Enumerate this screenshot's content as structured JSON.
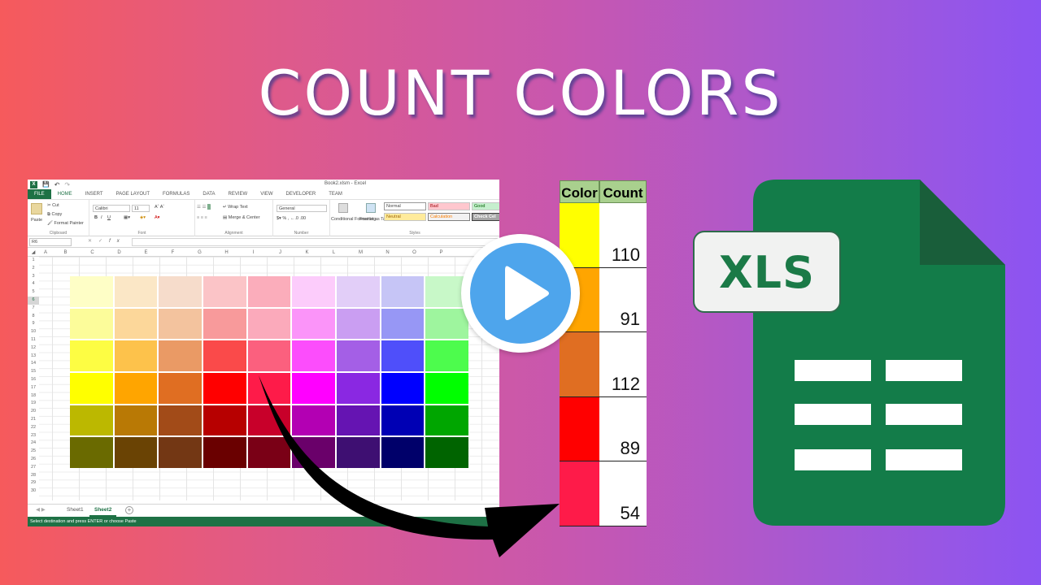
{
  "title": "COUNT COLORS",
  "excel": {
    "window_title": "Book2.xlsm - Excel",
    "tabs": [
      "FILE",
      "HOME",
      "INSERT",
      "PAGE LAYOUT",
      "FORMULAS",
      "DATA",
      "REVIEW",
      "VIEW",
      "DEVELOPER",
      "TEAM"
    ],
    "active_tab": "HOME",
    "ribbon": {
      "clipboard": {
        "paste": "Paste",
        "cut": "Cut",
        "copy": "Copy",
        "format_painter": "Format Painter",
        "label": "Clipboard"
      },
      "font": {
        "font_name": "Calibri",
        "font_size": "11",
        "bold": "B",
        "italic": "I",
        "underline": "U",
        "label": "Font"
      },
      "alignment": {
        "wrap_text": "Wrap Text",
        "merge_center": "Merge & Center",
        "label": "Alignment"
      },
      "number": {
        "format": "General",
        "label": "Number"
      },
      "styles": {
        "conditional_formatting": "Conditional Formatting",
        "format_as_table": "Format as Table",
        "cells": [
          "Normal",
          "Bad",
          "Good",
          "Neutral",
          "Calculation",
          "Check Cel"
        ],
        "label": "Styles"
      }
    },
    "name_box": "R6",
    "formula_value": "",
    "columns": [
      "A",
      "B",
      "C",
      "D",
      "E",
      "F",
      "G",
      "H",
      "I",
      "J",
      "K",
      "L",
      "M",
      "N",
      "O",
      "P"
    ],
    "rows": [
      "1",
      "2",
      "3",
      "4",
      "5",
      "6",
      "7",
      "8",
      "9",
      "10",
      "11",
      "12",
      "13",
      "14",
      "15",
      "16",
      "17",
      "18",
      "19",
      "20",
      "21",
      "22",
      "23",
      "24",
      "25",
      "26",
      "27",
      "28",
      "29",
      "30"
    ],
    "selected_row": "6",
    "swatch_colors": [
      [
        "#fefec6",
        "#fbe7c6",
        "#f6dccb",
        "#fbc4c7",
        "#fbadbb",
        "#fcccfb",
        "#e2cef8",
        "#c6c5f6",
        "#c8f8c8"
      ],
      [
        "#fcfc9a",
        "#fcd79a",
        "#f3c39e",
        "#f89a9b",
        "#fbaabb",
        "#fb94f9",
        "#ca9ef2",
        "#9797f5",
        "#9ef59e"
      ],
      [
        "#fdfd43",
        "#fdc24b",
        "#ea9a65",
        "#fa4a4a",
        "#fb607e",
        "#fc4dfc",
        "#a45fe6",
        "#4f4ffa",
        "#4dfc4d"
      ],
      [
        "#ffff00",
        "#ffa500",
        "#e06e22",
        "#ff0000",
        "#fe1b49",
        "#ff00ff",
        "#8a28e2",
        "#0000ff",
        "#00ff00"
      ],
      [
        "#bcb800",
        "#b97905",
        "#a24b18",
        "#b70000",
        "#c8002a",
        "#b300b3",
        "#6514b2",
        "#0000b4",
        "#00a600"
      ],
      [
        "#6a6a00",
        "#6a4304",
        "#733714",
        "#6a0000",
        "#7a0016",
        "#6a006a",
        "#3e0f72",
        "#00006a",
        "#006400"
      ]
    ],
    "sheets": [
      "Sheet1",
      "Sheet2"
    ],
    "active_sheet": "Sheet2",
    "status_text": "Select destination and press ENTER or choose Paste"
  },
  "count_table": {
    "headers": [
      "Color",
      "Count"
    ],
    "rows": [
      {
        "color": "#ffff00",
        "count": "110"
      },
      {
        "color": "#ffa500",
        "count": "91"
      },
      {
        "color": "#e06e22",
        "count": "112"
      },
      {
        "color": "#ff0000",
        "count": "89"
      },
      {
        "color": "#fe1b49",
        "count": "54"
      }
    ]
  },
  "badge": {
    "label": "XLS"
  },
  "icons": {
    "play": "play-button-icon",
    "arrow": "curved-arrow-icon",
    "file": "spreadsheet-file-icon"
  },
  "colors": {
    "excel_green": "#1e7145",
    "play_blue": "#4ea5ec",
    "sheets_green": "#137c49",
    "header_green": "#a9d08e"
  }
}
